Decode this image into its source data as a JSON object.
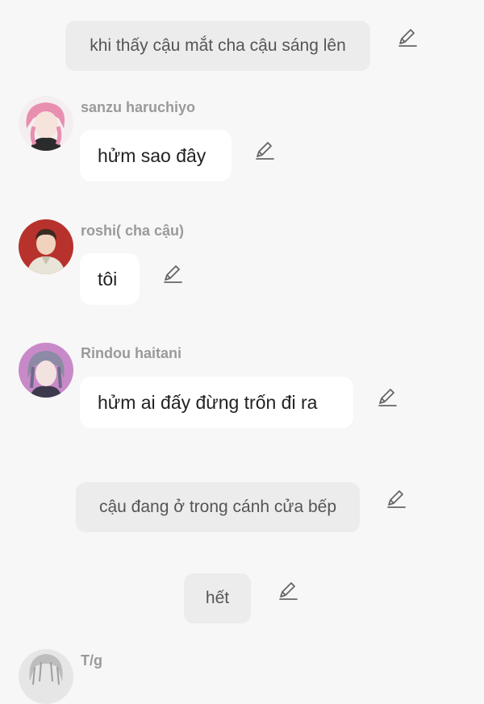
{
  "messages": [
    {
      "type": "narration",
      "text": "khi thấy cậu mắt cha cậu sáng lên"
    },
    {
      "type": "character",
      "name": "sanzu haruchiyo",
      "text": "hửm sao đây",
      "avatar_icon": "pink-hair-character-avatar"
    },
    {
      "type": "character",
      "name": "roshi( cha  cậu)",
      "text": "tôi",
      "avatar_icon": "red-background-man-avatar"
    },
    {
      "type": "character",
      "name": "Rindou haitani",
      "text": "hửm ai đấy đừng trốn  đi ra",
      "avatar_icon": "purple-hair-character-avatar"
    },
    {
      "type": "narration",
      "text": "cậu đang ở trong cánh cửa bếp"
    },
    {
      "type": "narration",
      "text": "hết"
    },
    {
      "type": "character",
      "name": "T/g",
      "avatar_icon": "grey-character-avatar"
    }
  ],
  "edit_icon": "pencil-edit-icon",
  "colors": {
    "background": "#f7f7f7",
    "narration_bubble": "#ececec",
    "character_bubble": "#ffffff",
    "name_text": "#9a9a9a"
  }
}
